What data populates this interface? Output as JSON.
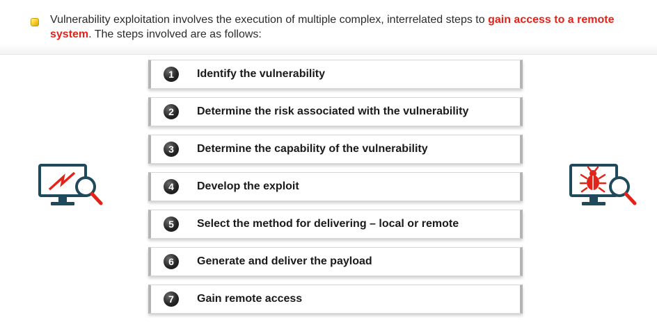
{
  "intro": {
    "text_before": "Vulnerability exploitation involves the execution of multiple complex, interrelated steps to ",
    "highlight": "gain access to a remote system",
    "text_after": ". The steps involved are as follows:"
  },
  "steps": [
    {
      "number": "1",
      "label": "Identify the vulnerability"
    },
    {
      "number": "2",
      "label": "Determine the risk associated with the vulnerability"
    },
    {
      "number": "3",
      "label": "Determine the capability of the vulnerability"
    },
    {
      "number": "4",
      "label": "Develop the exploit"
    },
    {
      "number": "5",
      "label": "Select the method for delivering – local or remote"
    },
    {
      "number": "6",
      "label": "Generate and deliver the payload"
    },
    {
      "number": "7",
      "label": "Gain remote access"
    }
  ],
  "icons": {
    "left": "monitor-lightning-magnifier-icon",
    "right": "monitor-bug-magnifier-icon"
  },
  "colors": {
    "highlight": "#e2231a",
    "monitor": "#1e4a5c",
    "accent": "#e2231a"
  }
}
